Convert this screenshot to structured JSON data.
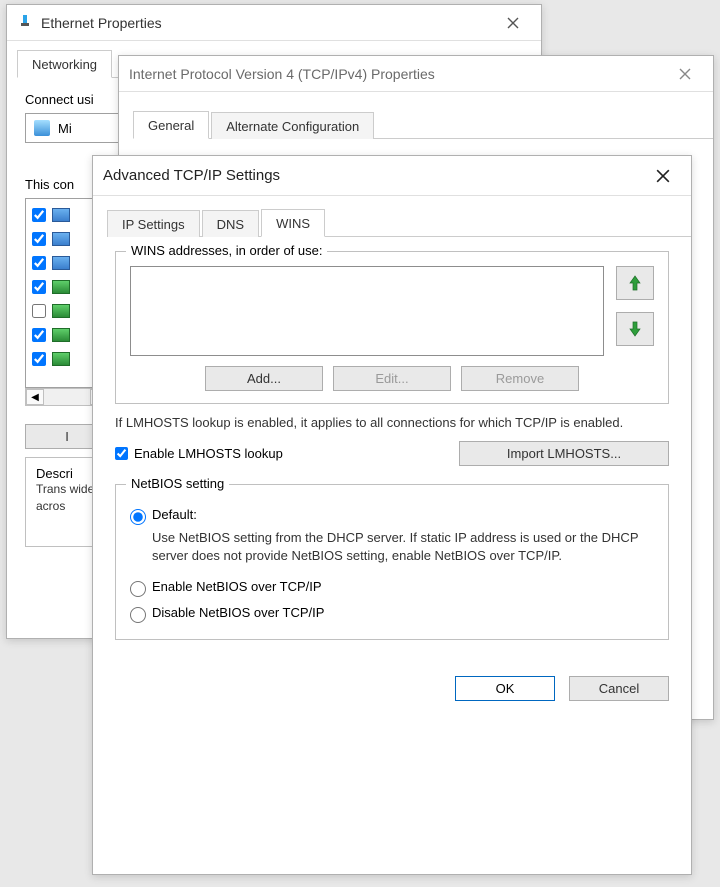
{
  "ethernet": {
    "title": "Ethernet Properties",
    "tab_networking": "Networking",
    "connect_using_label": "Connect usi",
    "connect_value_partial": "Mi",
    "this_conn_label": "This con",
    "items": [
      {
        "checked": true,
        "icon": "blue"
      },
      {
        "checked": true,
        "icon": "blue"
      },
      {
        "checked": true,
        "icon": "blue"
      },
      {
        "checked": true,
        "icon": "green"
      },
      {
        "checked": false,
        "icon": "green"
      },
      {
        "checked": true,
        "icon": "green"
      },
      {
        "checked": true,
        "icon": "green"
      }
    ],
    "install_btn": "I",
    "desc_legend": "Descri",
    "desc_text": "Trans\nwide\nacros"
  },
  "ipv4": {
    "title": "Internet Protocol Version 4 (TCP/IPv4) Properties",
    "tab_general": "General",
    "tab_alt": "Alternate Configuration"
  },
  "adv": {
    "title": "Advanced TCP/IP Settings",
    "tab_ip": "IP Settings",
    "tab_dns": "DNS",
    "tab_wins": "WINS",
    "wins_legend": "WINS addresses, in order of use:",
    "btn_add": "Add...",
    "btn_edit": "Edit...",
    "btn_remove": "Remove",
    "lmhosts_note": "If LMHOSTS lookup is enabled, it applies to all connections for which TCP/IP is enabled.",
    "chk_lmhosts": "Enable LMHOSTS lookup",
    "btn_import": "Import LMHOSTS...",
    "netbios_legend": "NetBIOS setting",
    "opt_default": "Default:",
    "opt_default_desc": "Use NetBIOS setting from the DHCP server. If static IP address is used or the DHCP server does not provide NetBIOS setting, enable NetBIOS over TCP/IP.",
    "opt_enable": "Enable NetBIOS over TCP/IP",
    "opt_disable": "Disable NetBIOS over TCP/IP",
    "btn_ok": "OK",
    "btn_cancel": "Cancel"
  }
}
